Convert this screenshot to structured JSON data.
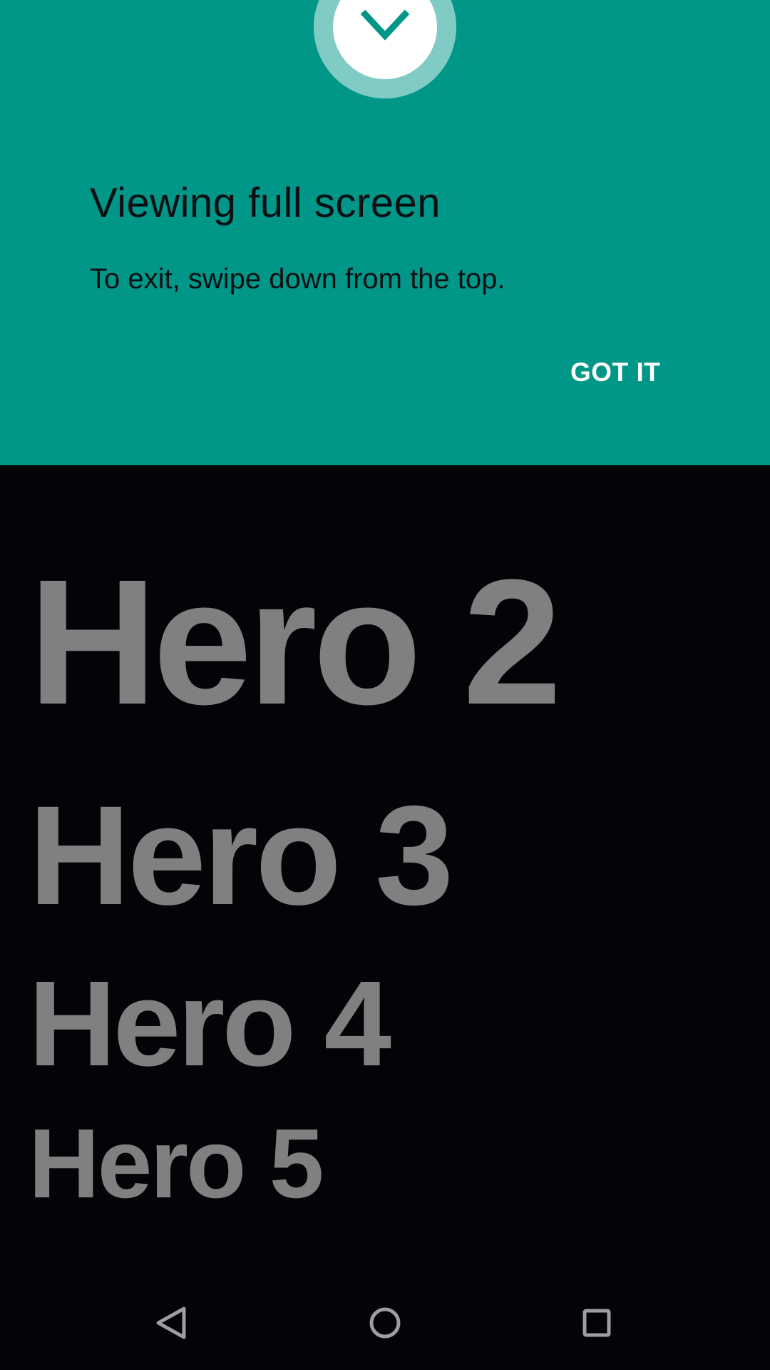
{
  "confirmation": {
    "title": "Viewing full screen",
    "message": "To exit, swipe down from the top.",
    "button_label": "GOT IT",
    "icon": "chevron-down-icon"
  },
  "content": {
    "heroes": [
      "Hero 2",
      "Hero 3",
      "Hero 4",
      "Hero 5"
    ]
  },
  "navigation": {
    "back_icon": "back-triangle-icon",
    "home_icon": "home-circle-icon",
    "recents_icon": "recents-square-icon"
  },
  "colors": {
    "banner": "#009688",
    "ring": "#80cbc4",
    "background": "#030408",
    "hero_text": "#808080",
    "nav_icon": "#9e9e9e"
  }
}
